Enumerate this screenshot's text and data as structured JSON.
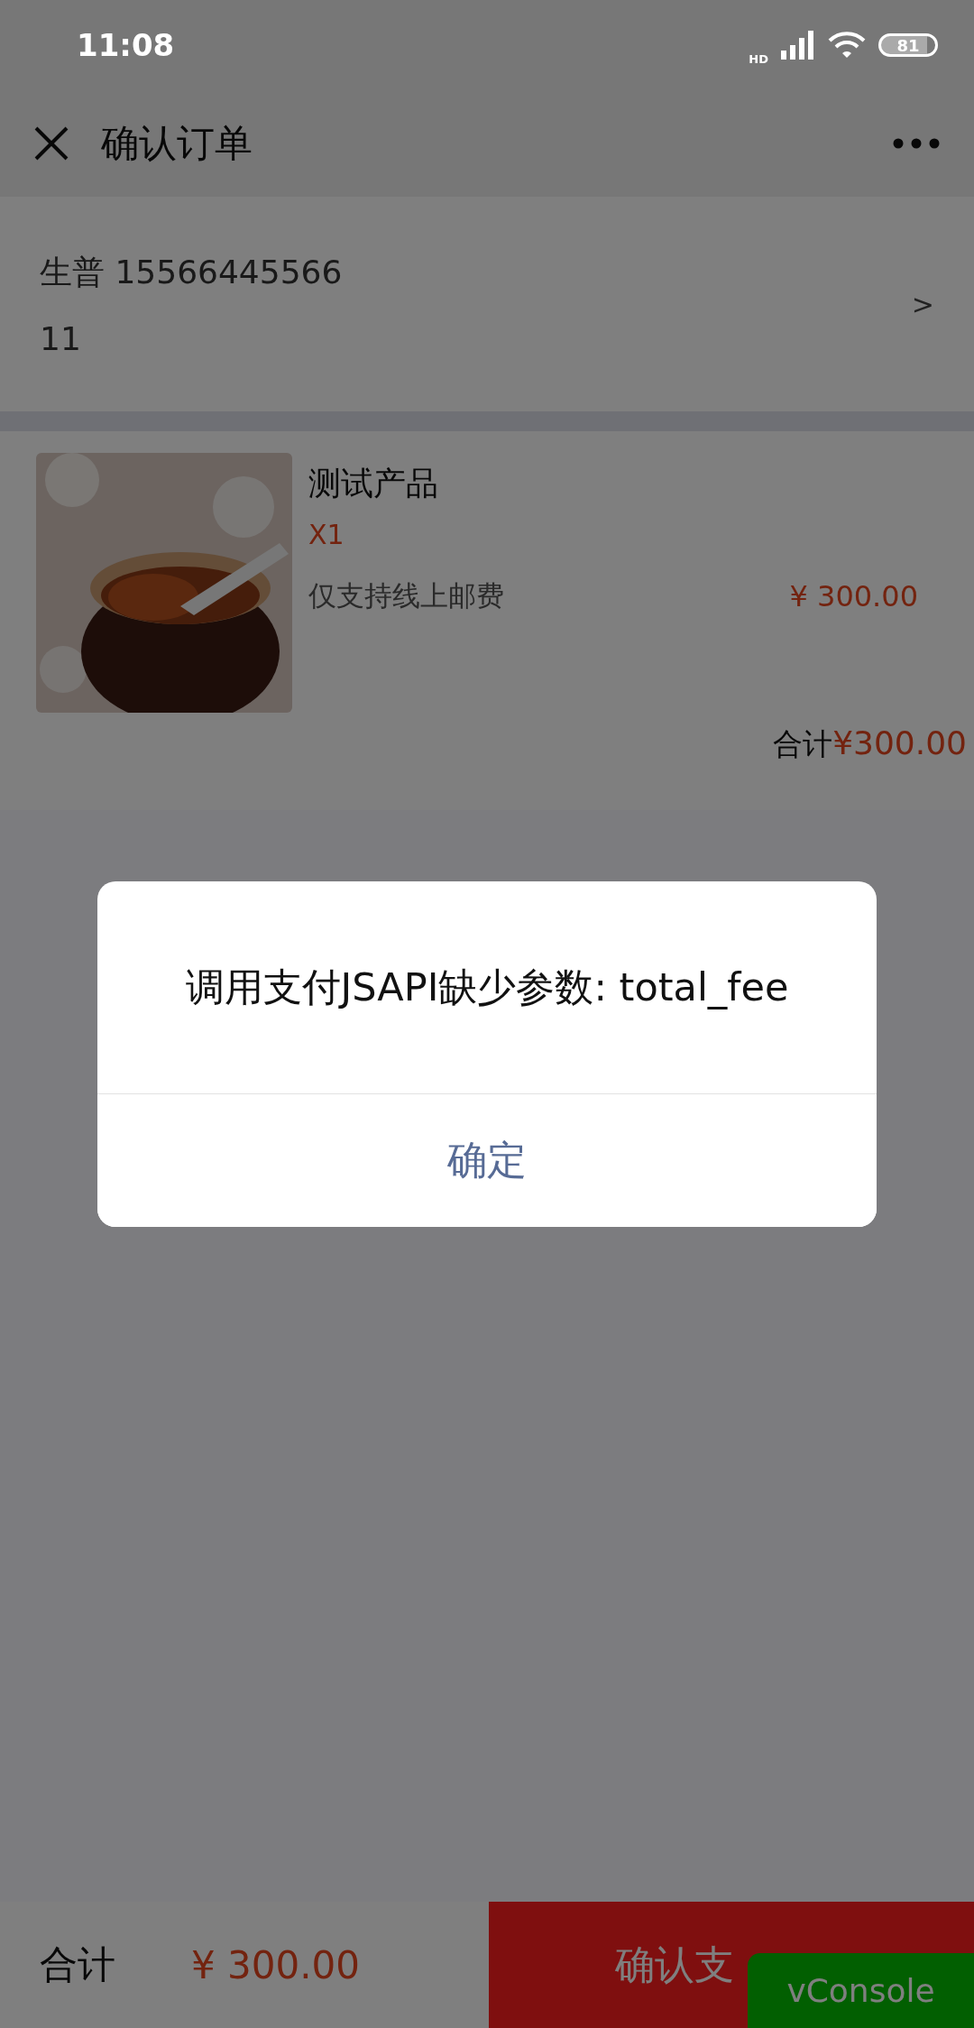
{
  "status_bar": {
    "time": "11:08",
    "network": "HD",
    "battery": "81"
  },
  "header": {
    "title": "确认订单"
  },
  "address": {
    "name_phone": "生普 15566445566",
    "detail": "11",
    "chevron": ">"
  },
  "order": {
    "items": [
      {
        "name": "测试产品",
        "quantity": "X1",
        "shipping_note": "仅支持线上邮费",
        "price": "¥ 300.00"
      }
    ],
    "total_label": "合计",
    "total_amount": "¥300.00"
  },
  "dialog": {
    "message": "调用支付JSAPI缺少参数: total_fee",
    "confirm": "确定"
  },
  "bottom_bar": {
    "total_label": "合计",
    "total_amount": "¥ 300.00",
    "pay_button": "确认支"
  },
  "vconsole": {
    "label": "vConsole"
  }
}
